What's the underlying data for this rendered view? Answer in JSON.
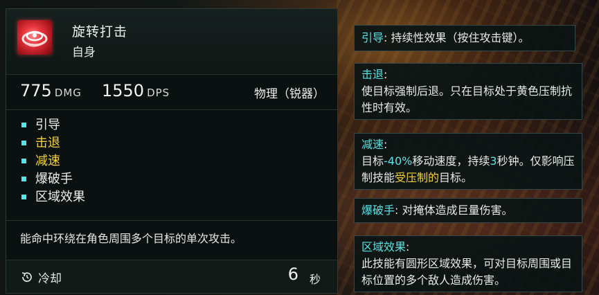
{
  "skill": {
    "name": "旋转打击",
    "type": "自身",
    "icon": "spin-strike-icon",
    "icon_color": "#e8353d"
  },
  "stats": {
    "dmg_value": "775",
    "dmg_unit": "DMG",
    "dps_value": "1550",
    "dps_unit": "DPS",
    "damage_type": "物理（锐器）"
  },
  "tags": [
    {
      "label": "引导",
      "highlight": false
    },
    {
      "label": "击退",
      "highlight": true
    },
    {
      "label": "减速",
      "highlight": true
    },
    {
      "label": "爆破手",
      "highlight": false
    },
    {
      "label": "区域效果",
      "highlight": false
    }
  ],
  "description": "能命中环绕在角色周围多个目标的单次攻击。",
  "cooldown": {
    "label": "冷却",
    "value": "6",
    "unit": "秒",
    "icon": "cooldown-icon"
  },
  "tooltips": {
    "channel": {
      "title": "引导",
      "text": ": 持续性效果（按住攻击键）。"
    },
    "knockback": {
      "title": "击退",
      "colon": ":",
      "text": "使目标强制后退。只在目标处于黄色压制抗性时有效。"
    },
    "slow": {
      "title": "减速",
      "colon": ":",
      "text_1": "目标",
      "value_1": "-40%",
      "text_2": "移动速度，持续",
      "value_2": "3",
      "text_3": "秒钟。仅影响压制技能",
      "value_3": "受压制的",
      "text_4": "目标。"
    },
    "demolisher": {
      "title": "爆破手",
      "text": ": 对掩体造成巨量伤害。"
    },
    "aoe": {
      "title": "区域效果",
      "colon": ":",
      "text": "此技能有圆形区域效果，可对目标周围或目标位置的多个敌人造成伤害。"
    }
  },
  "colors": {
    "accent_cyan": "#57e4e6",
    "accent_yellow": "#f3d23a",
    "panel_bg": "#0a1110"
  }
}
